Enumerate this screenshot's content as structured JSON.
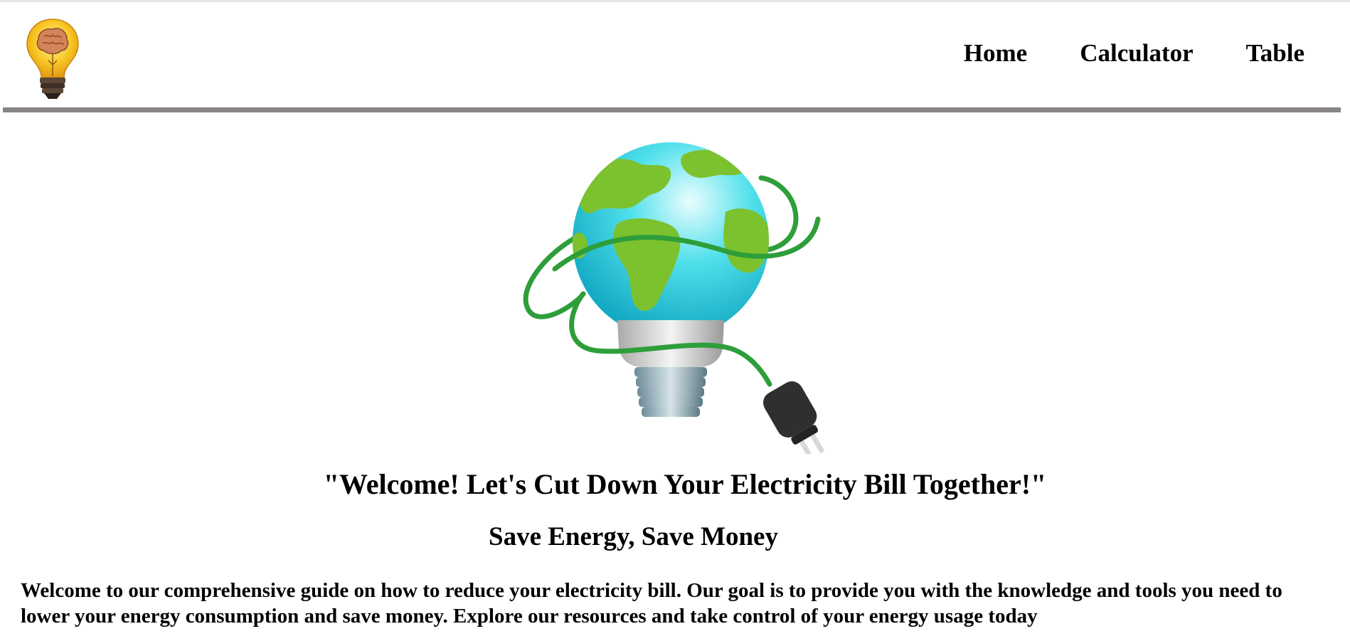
{
  "nav": {
    "items": [
      {
        "label": "Home"
      },
      {
        "label": "Calculator"
      },
      {
        "label": "Table"
      }
    ]
  },
  "logo": {
    "icon": "brain-lightbulb-icon"
  },
  "hero": {
    "icon": "earth-lightbulb-plug-icon"
  },
  "main": {
    "headline": "\"Welcome! Let's Cut Down Your Electricity Bill Together!\"",
    "subheading": "Save Energy, Save Money",
    "intro": "Welcome to our comprehensive guide on how to reduce your electricity bill. Our goal is to provide you with the knowledge and tools you need to lower your energy consumption and save money. Explore our resources and take control of your energy usage today"
  },
  "colors": {
    "divider": "#888385",
    "earth_land": "#7cc12e",
    "earth_ocean": "#33d3e0",
    "cable": "#2e9e3a"
  }
}
